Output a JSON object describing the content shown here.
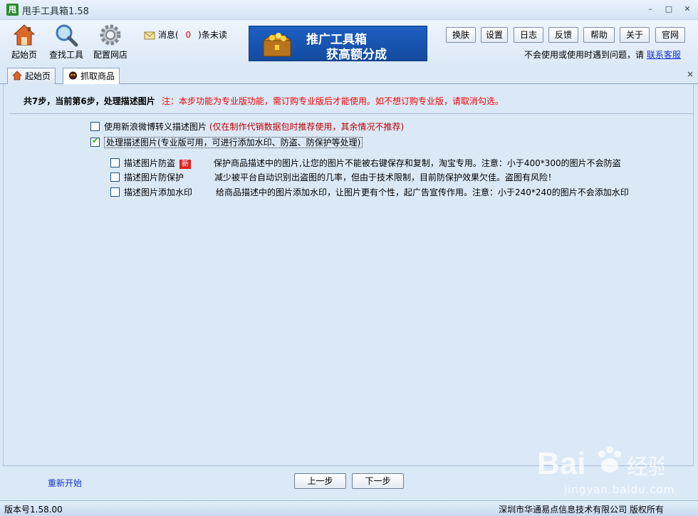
{
  "window": {
    "logo": "甩",
    "title": "甩手工具箱1.58",
    "minimize_glyph": "–",
    "maximize_glyph": "□",
    "close_glyph": "✕"
  },
  "toolbar": {
    "home_label": "起始页",
    "search_label": "查找工具",
    "config_label": "配置网店",
    "msg_prefix": "消息(",
    "msg_count": "0",
    "msg_suffix": ")条未读",
    "banner_line1": "推广工具箱",
    "banner_line2": "获高额分成",
    "buttons": [
      "换肤",
      "设置",
      "日志",
      "反馈",
      "帮助",
      "关于",
      "官网"
    ],
    "help_text": "不会使用或使用时遇到问题，请",
    "help_link": "联系客服"
  },
  "tabs": [
    {
      "label": "起始页"
    },
    {
      "label": "抓取商品"
    }
  ],
  "tab_close_glyph": "×",
  "step": {
    "heading": "共7步，当前第6步，处理描述图片",
    "note": "注：本步功能为专业版功能，需订购专业版后才能使用。如不想订购专业版，请取消勾选。"
  },
  "options": {
    "weibo": {
      "label": "使用新浪微博转义描述图片",
      "hint": "(仅在制作代销数据包时推荐使用，其余情况不推荐)",
      "checked": false
    },
    "process": {
      "label": "处理描述图片(专业版可用，可进行添加水印、防盗、防保护等处理)",
      "checked": true
    },
    "sub": [
      {
        "label": "描述图片防盗",
        "badge": "新",
        "desc": "保护商品描述中的图片,让您的图片不能被右键保存和复制，淘宝专用。注意：小于400*300的图片不会防盗"
      },
      {
        "label": "描述图片防保护",
        "desc": "减少被平台自动识别出盗图的几率，但由于技术限制，目前防保护效果欠佳。盗图有风险！"
      },
      {
        "label": "描述图片添加水印",
        "desc": "给商品描述中的图片添加水印，让图片更有个性，起广告宣传作用。注意：小于240*240的图片不会添加水印"
      }
    ]
  },
  "bottom": {
    "restart": "重新开始",
    "prev": "上一步",
    "next": "下一步"
  },
  "status": {
    "version": "版本号1.58.00",
    "copyright": "深圳市华通易点信息技术有限公司  版权所有"
  },
  "watermark": {
    "text_sub": "jingyan.baidu.com"
  }
}
